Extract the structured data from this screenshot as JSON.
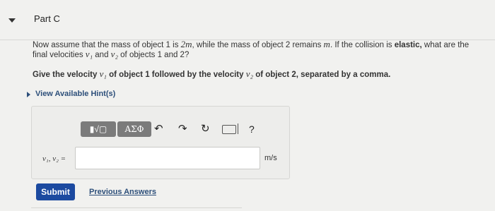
{
  "part": {
    "title": "Part C"
  },
  "question": {
    "line1_a": "Now assume that the mass of object 1 is ",
    "line1_m2": "2m",
    "line1_b": ", while the mass of object 2 remains ",
    "line1_m": "m",
    "line1_c": ". If the collision is ",
    "line1_elastic": "elastic,",
    "line1_d": " what are the",
    "line2_a": "final velocities ",
    "line2_v1": "v₁",
    "line2_b": " and ",
    "line2_v2": "v₂",
    "line2_c": " of objects 1 and 2?",
    "instr_a": "Give the velocity ",
    "instr_v1": "v₁",
    "instr_b": " of object 1 followed by the velocity ",
    "instr_v2": "v₂",
    "instr_c": " of object 2, separated by a comma."
  },
  "hints": {
    "label": "View Available Hint(s)"
  },
  "toolbar": {
    "templates_label": "▮√▢",
    "greek_label": "ΑΣΦ",
    "undo_icon": "undo-icon",
    "redo_icon": "redo-icon",
    "reset_icon": "reset-icon",
    "keyboard_icon": "keyboard-icon",
    "help_label": "?"
  },
  "answer": {
    "variable_label": "v₁, v₂ =",
    "value": "",
    "unit": "m/s"
  },
  "actions": {
    "submit_label": "Submit",
    "previous_answers_label": "Previous Answers"
  },
  "colors": {
    "submit_bg": "#1c4aa0",
    "link": "#2d4f7a",
    "toolbar_btn": "#7b7b7b"
  }
}
